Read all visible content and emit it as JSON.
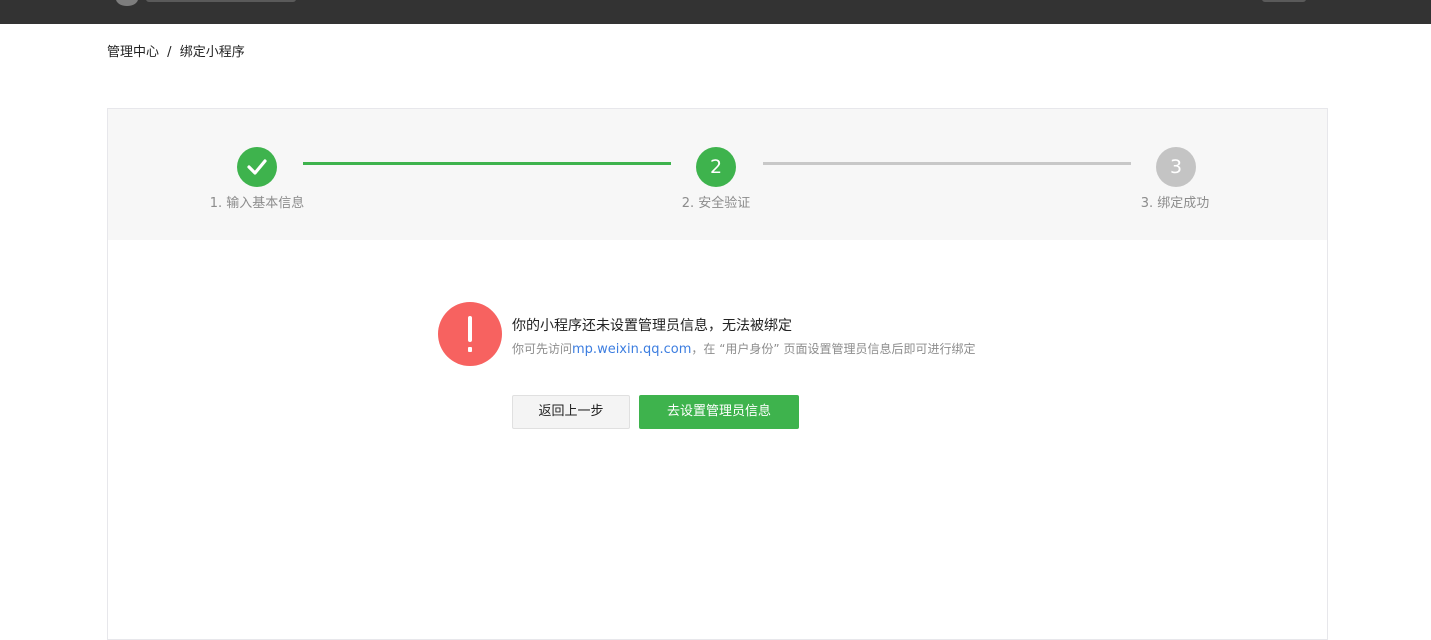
{
  "breadcrumb": {
    "home": "管理中心",
    "separator": "/",
    "current": "绑定小程序"
  },
  "steps": [
    {
      "label": "1. 输入基本信息",
      "status": "done",
      "icon": "check-icon"
    },
    {
      "number": "2",
      "label": "2. 安全验证",
      "status": "current"
    },
    {
      "number": "3",
      "label": "3. 绑定成功",
      "status": "todo"
    }
  ],
  "notice": {
    "icon": "exclamation-icon",
    "title": "你的小程序还未设置管理员信息，无法被绑定",
    "desc_prefix": "你可先访问",
    "desc_link": "mp.weixin.qq.com",
    "desc_suffix": "，在 “用户身份” 页面设置管理员信息后即可进行绑定"
  },
  "buttons": {
    "back": "返回上一步",
    "setup": "去设置管理员信息"
  },
  "colors": {
    "topbar": "#333333",
    "accent_green": "#3eb34d",
    "step_inactive": "#c4c4c4",
    "warning_red": "#f76260",
    "link_blue": "#3d7ee0"
  }
}
